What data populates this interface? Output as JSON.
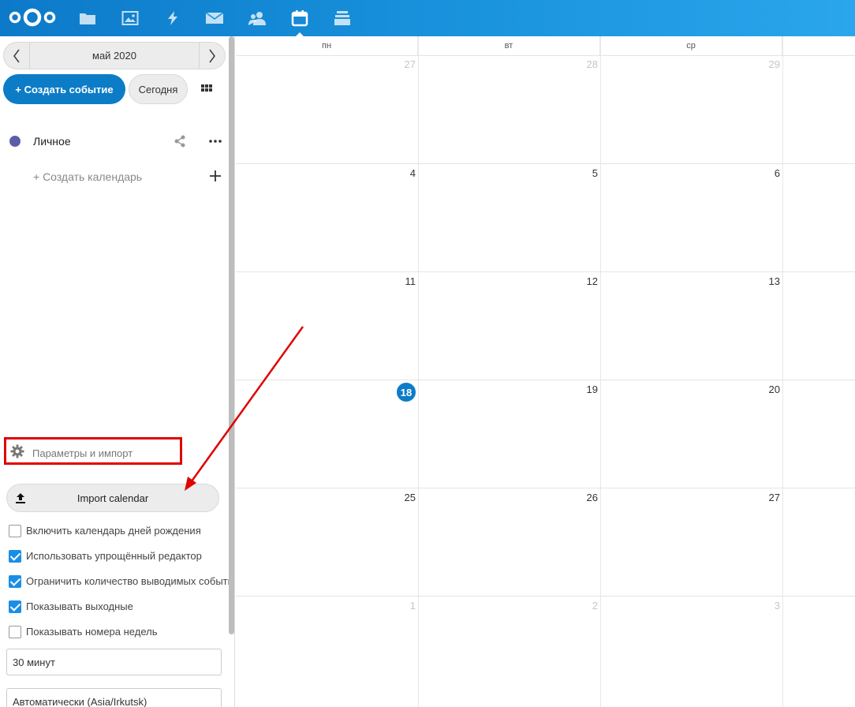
{
  "sidebar": {
    "date_nav": {
      "label": "май 2020"
    },
    "create_event_label": "+ Создать событие",
    "today_label": "Сегодня",
    "calendars": [
      {
        "name": "Личное",
        "color": "#5b5ea6"
      }
    ],
    "new_calendar_label": "+ Создать календарь",
    "settings_label": "Параметры и импорт",
    "import_label": "Import calendar",
    "options": [
      {
        "label": "Включить календарь дней рождения",
        "checked": false
      },
      {
        "label": "Использовать упрощённый редактор",
        "checked": true
      },
      {
        "label": "Ограничить количество выводимых событий",
        "checked": true
      },
      {
        "label": "Показывать выходные",
        "checked": true
      },
      {
        "label": "Показывать номера недель",
        "checked": false
      }
    ],
    "slot_duration": "30 минут",
    "timezone": "Автоматически (Asia/Irkutsk)"
  },
  "calendar": {
    "weekdays": [
      "пн",
      "вт",
      "ср"
    ],
    "weeks": [
      [
        "27",
        "28",
        "29"
      ],
      [
        "4",
        "5",
        "6"
      ],
      [
        "11",
        "12",
        "13"
      ],
      [
        "18",
        "19",
        "20"
      ],
      [
        "25",
        "26",
        "27"
      ],
      [
        "1",
        "2",
        "3"
      ]
    ],
    "muted_weeks": [
      0,
      5
    ],
    "today": "18",
    "accent_color": "#0c7cc7"
  },
  "apps": [
    "files-icon",
    "photos-icon",
    "activity-icon",
    "mail-icon",
    "contacts-icon",
    "calendar-icon",
    "deck-icon"
  ]
}
